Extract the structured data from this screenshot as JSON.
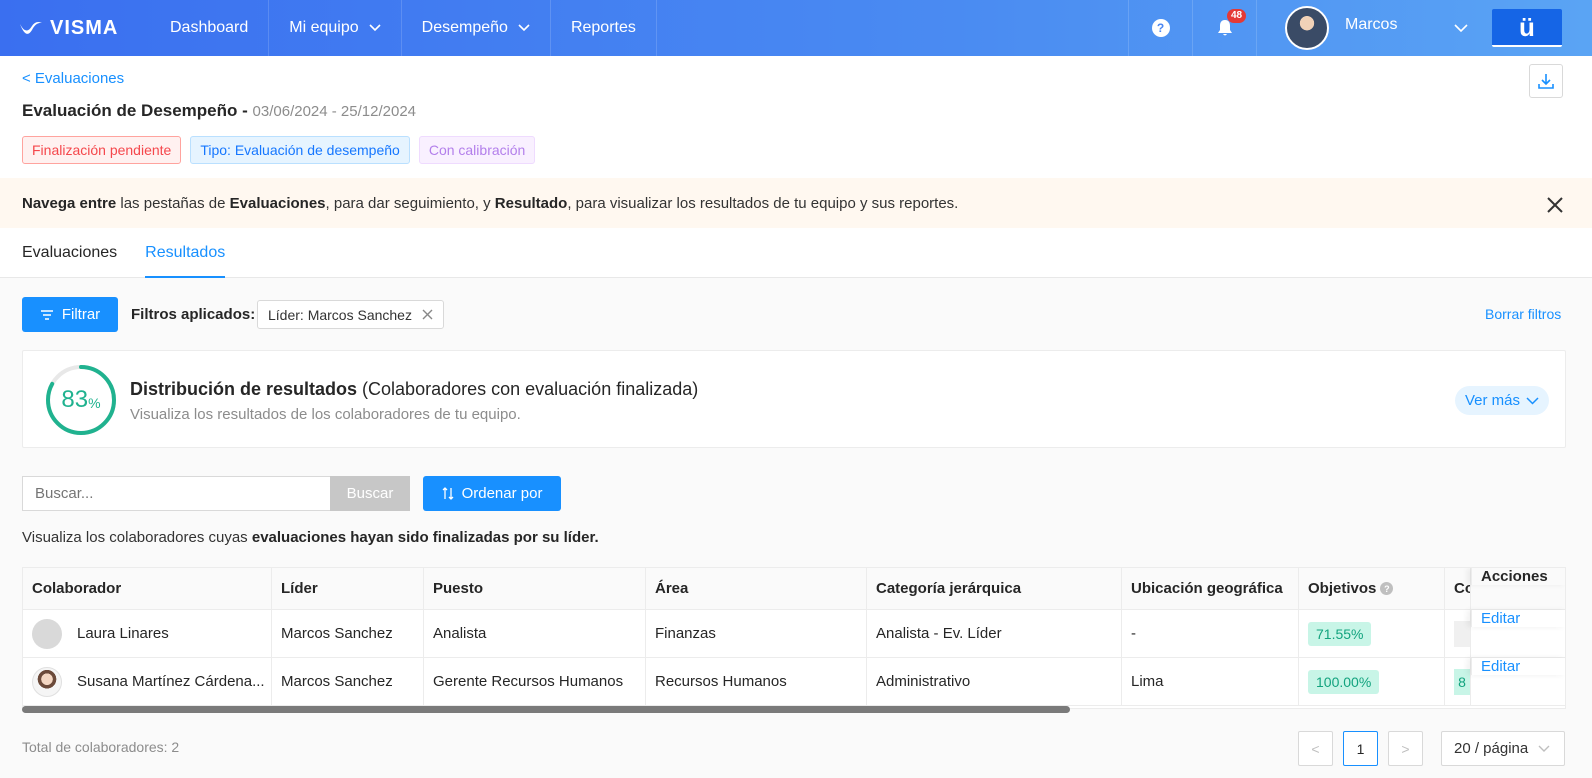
{
  "brand": {
    "logo_text": "VISMA",
    "accent": "#1890ff",
    "nav_gradient_start": "#3a6ff0",
    "nav_gradient_end": "#5aa4f4"
  },
  "nav": {
    "items": [
      {
        "label": "Dashboard",
        "dropdown": false
      },
      {
        "label": "Mi equipo",
        "dropdown": true
      },
      {
        "label": "Desempeño",
        "dropdown": true
      },
      {
        "label": "Reportes",
        "dropdown": false
      }
    ],
    "help_icon": "question-circle-icon",
    "help_symbol": "?",
    "notifications_icon": "bell-icon",
    "notifications_count": "48",
    "user_name": "Marcos",
    "app_symbol": "ü"
  },
  "header": {
    "back_label": "< Evaluaciones",
    "title": "Evaluación de Desempeño -",
    "dates": "03/06/2024 - 25/12/2024",
    "tags": [
      {
        "label": "Finalización pendiente",
        "color": "#f5474c"
      },
      {
        "label": "Tipo: Evaluación de desempeño",
        "color": "#1677ff"
      },
      {
        "label": "Con calibración",
        "color": "#b37feb"
      }
    ]
  },
  "banner": {
    "part1_bold": "Navega entre",
    "part2": " las pestañas de ",
    "part3_bold": "Evaluaciones",
    "part4": ", para dar seguimiento, y ",
    "part5_bold": "Resultado",
    "part6": ", para visualizar los resultados de tu equipo y sus reportes."
  },
  "tabs": [
    {
      "label": "Evaluaciones",
      "active": false
    },
    {
      "label": "Resultados",
      "active": true
    }
  ],
  "filters": {
    "button_label": "Filtrar",
    "applied_label": "Filtros aplicados:",
    "chips": [
      {
        "label": "Líder: Marcos Sanchez"
      }
    ],
    "clear_label": "Borrar filtros"
  },
  "distribution": {
    "percent": 83,
    "percent_value": "83",
    "percent_sign": "%",
    "title_bold": "Distribución de resultados",
    "title_rest": " (Colaboradores con evaluación finalizada)",
    "subtitle": "Visualiza los resultados de los colaboradores de tu equipo.",
    "more_label": "Ver más",
    "ring_color": "#20b28f"
  },
  "search": {
    "placeholder": "Buscar...",
    "button_label": "Buscar",
    "sort_label": "Ordenar por"
  },
  "table_desc": {
    "text": "Visualiza los colaboradores cuyas ",
    "bold": "evaluaciones hayan sido finalizadas por su líder."
  },
  "table": {
    "columns": [
      "Colaborador",
      "Líder",
      "Puesto",
      "Área",
      "Categoría jerárquica",
      "Ubicación geográfica",
      "Objetivos",
      "Co",
      "Acciones"
    ],
    "objectives_help_symbol": "?",
    "rows": [
      {
        "colaborador": "Laura Linares",
        "lider": "Marcos Sanchez",
        "puesto": "Analista",
        "area": "Finanzas",
        "categoria": "Analista - Ev. Líder",
        "ubicacion": "-",
        "objetivos": "71.55%",
        "co": "",
        "accion": "Editar"
      },
      {
        "colaborador": "Susana Martínez Cárdena...",
        "lider": "Marcos Sanchez",
        "puesto": "Gerente Recursos Humanos",
        "area": "Recursos Humanos",
        "categoria": "Administrativo",
        "ubicacion": "Lima",
        "objetivos": "100.00%",
        "co": "8",
        "accion": "Editar"
      }
    ]
  },
  "footer": {
    "total_label": "Total de colaboradores: 2",
    "prev_symbol": "<",
    "next_symbol": ">",
    "current_page": "1",
    "page_size": "20 / página"
  }
}
